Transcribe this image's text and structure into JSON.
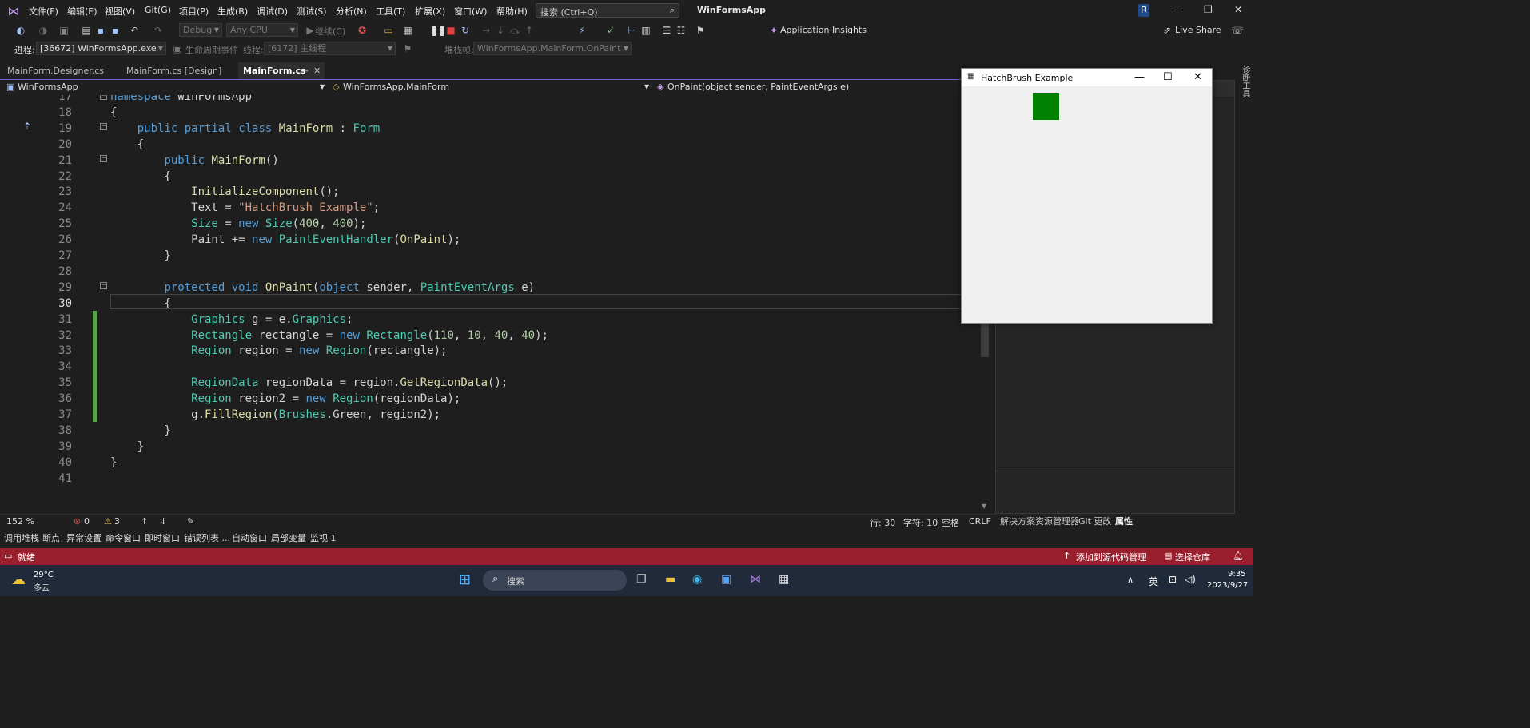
{
  "menu": {
    "items": [
      "文件(F)",
      "编辑(E)",
      "视图(V)",
      "Git(G)",
      "项目(P)",
      "生成(B)",
      "调试(D)",
      "测试(S)",
      "分析(N)",
      "工具(T)",
      "扩展(X)",
      "窗口(W)",
      "帮助(H)"
    ],
    "search_placeholder": "搜索 (Ctrl+Q)",
    "app_title": "WinFormsApp",
    "avatar_letter": "R"
  },
  "toolbar1": {
    "config": "Debug",
    "platform": "Any CPU",
    "continue_label": "继续(C)",
    "app_insights": "Application Insights",
    "live_share": "Live Share"
  },
  "toolbar2": {
    "process_label": "进程:",
    "process_value": "[36672] WinFormsApp.exe",
    "lifecycle_label": "生命周期事件",
    "thread_label": "线程:",
    "thread_value": "[6172] 主线程",
    "stackframe_label": "堆栈帧:",
    "stackframe_value": "WinFormsApp.MainForm.OnPaint"
  },
  "tabs": [
    {
      "label": "MainForm.Designer.cs"
    },
    {
      "label": "MainForm.cs [Design]"
    },
    {
      "label": "MainForm.cs"
    }
  ],
  "nav": {
    "project": "WinFormsApp",
    "class": "WinFormsApp.MainForm",
    "member": "OnPaint(object sender, PaintEventArgs e)"
  },
  "code": {
    "line_numbers": [
      "17",
      "18",
      "19",
      "20",
      "21",
      "22",
      "23",
      "24",
      "25",
      "26",
      "27",
      "28",
      "29",
      "30",
      "31",
      "32",
      "33",
      "34",
      "35",
      "36",
      "37",
      "38",
      "39",
      "40",
      "41"
    ],
    "lines": [
      "namespace WinFormsApp",
      "{",
      "    public partial class MainForm : Form",
      "    {",
      "        public MainForm()",
      "        {",
      "            InitializeComponent();",
      "            Text = \"HatchBrush Example\";",
      "            Size = new Size(400, 400);",
      "            Paint += new PaintEventHandler(OnPaint);",
      "        }",
      "",
      "        protected void OnPaint(object sender, PaintEventArgs e)",
      "        {",
      "            Graphics g = e.Graphics;",
      "            Rectangle rectangle = new Rectangle(110, 10, 40, 40);",
      "            Region region = new Region(rectangle);",
      "",
      "            RegionData regionData = region.GetRegionData();",
      "            Region region2 = new Region(regionData);",
      "            g.FillRegion(Brushes.Green, region2);",
      "        }",
      "    }",
      "}",
      ""
    ]
  },
  "editor_status": {
    "zoom": "152 %",
    "errors": "0",
    "warnings": "3",
    "line": "行: 30",
    "char": "字符: 10",
    "whitespace": "空格",
    "eol": "CRLF"
  },
  "right_tabs": [
    "解决方案资源管理器",
    "Git 更改",
    "属性"
  ],
  "side_strip_label": "诊断工具",
  "tool_windows": [
    "调用堆栈",
    "断点",
    "异常设置",
    "命令窗口",
    "即时窗口",
    "错误列表 ...",
    "自动窗口",
    "局部变量",
    "监视 1"
  ],
  "status": {
    "ready": "就绪",
    "source_control": "添加到源代码管理",
    "repo": "选择仓库"
  },
  "taskbar": {
    "temp": "29°C",
    "weather": "多云",
    "search": "搜索",
    "ime": "英",
    "time": "9:35",
    "date": "2023/9/27"
  },
  "form_window": {
    "title": "HatchBrush Example",
    "fill_color": "#008000"
  }
}
